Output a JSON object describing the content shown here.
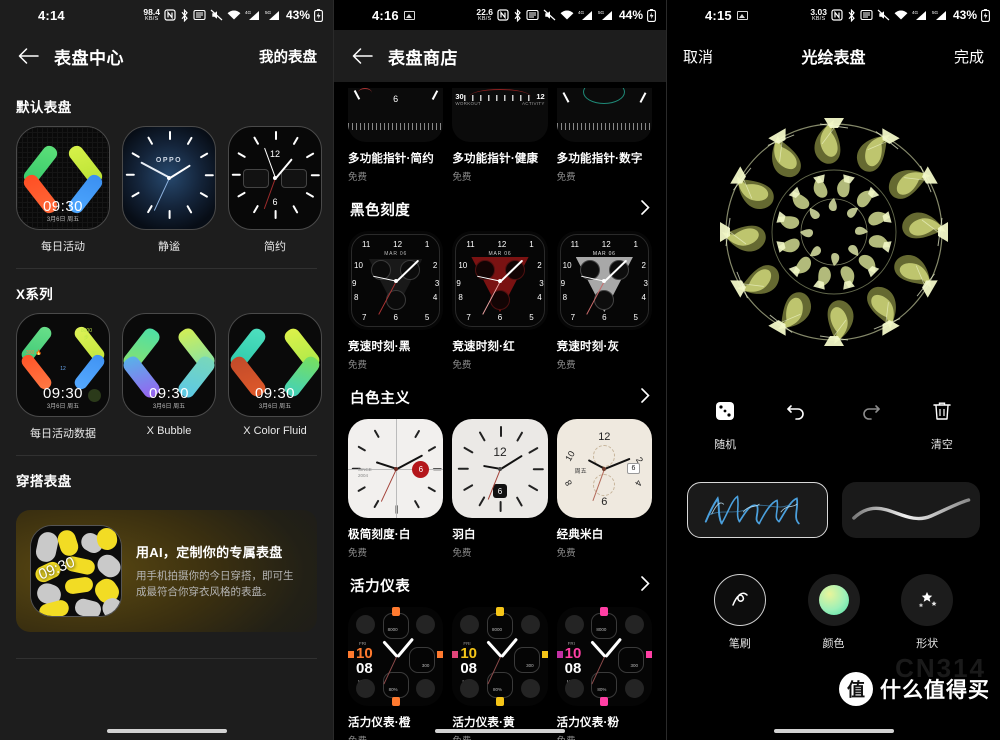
{
  "panel1": {
    "statusbar": {
      "time": "4:14",
      "net_speed": "98.4",
      "net_unit": "KB/S",
      "battery": "43%",
      "icons": [
        "nfc-icon",
        "bluetooth-icon",
        "screenshot-icon",
        "mute-icon",
        "wifi-icon",
        "signal-4g-icon",
        "signal-5g-icon",
        "battery-icon"
      ]
    },
    "header": {
      "back": "back-arrow-icon",
      "title": "表盘中心",
      "action": "我的表盘"
    },
    "sections": [
      {
        "title": "默认表盘",
        "faces": [
          {
            "label": "每日活动",
            "time": "09:30",
            "date": "3月6日 周五"
          },
          {
            "label": "静谧",
            "time": "",
            "date": ""
          },
          {
            "label": "简约",
            "time": "",
            "date": ""
          },
          {
            "label": "",
            "time": "",
            "date": ""
          }
        ]
      },
      {
        "title": "X系列",
        "faces": [
          {
            "label": "每日活动数据",
            "time": "09:30",
            "date": "3月6日 周五"
          },
          {
            "label": "X Bubble",
            "time": "09:30",
            "date": "3月6日 周五"
          },
          {
            "label": "X Color Fluid",
            "time": "09:30",
            "date": "3月6日 周五"
          },
          {
            "label": "",
            "time": "",
            "date": ""
          }
        ]
      },
      {
        "title": "穿搭表盘",
        "faces": []
      }
    ],
    "banner": {
      "time": "09:30",
      "heading": "用AI，定制你的专属表盘",
      "body": "用手机拍摄你的今日穿搭，即可生成最符合你穿衣风格的表盘。"
    }
  },
  "panel2": {
    "statusbar": {
      "time": "4:16",
      "net_speed": "22.6",
      "net_unit": "KB/S",
      "battery": "44%"
    },
    "header": {
      "back": "back-arrow-icon",
      "title": "表盘商店"
    },
    "top_partial": [
      {
        "name": "多功能指针·简约",
        "price": "免费",
        "dial_label": "6"
      },
      {
        "name": "多功能指针·健康",
        "price": "免费",
        "dial_left": "30",
        "dial_left_sub": "WORKOUT",
        "dial_right": "12",
        "dial_right_sub": "ACTIVITY"
      },
      {
        "name": "多功能指针·数字",
        "price": "免费",
        "dial_label": ""
      }
    ],
    "sections": [
      {
        "title": "黑色刻度",
        "more": "chevron-right-icon",
        "cards": [
          {
            "name": "竞速时刻·黑",
            "price": "免费",
            "date": "MAR 06",
            "accent": "#2a2a2a"
          },
          {
            "name": "竞速时刻·红",
            "price": "免费",
            "date": "MAR 06",
            "accent": "#7a1212"
          },
          {
            "name": "竞速时刻·灰",
            "price": "免费",
            "date": "MAR 06",
            "accent": "#9a9a9a"
          }
        ]
      },
      {
        "title": "白色主义",
        "more": "chevron-right-icon",
        "cards": [
          {
            "name": "极简刻度·白",
            "price": "免费",
            "accent": "#f2f0ee"
          },
          {
            "name": "羽白",
            "price": "免费",
            "accent": "#ebe9e6"
          },
          {
            "name": "经典米白",
            "price": "免费",
            "accent": "#efe9df"
          }
        ]
      },
      {
        "title": "活力仪表",
        "more": "chevron-right-icon",
        "cards": [
          {
            "name": "活力仪表·橙",
            "price": "免费",
            "accent": "#ff7a2f",
            "day": "FRI",
            "hour": "10",
            "min": "08",
            "month": "MAR",
            "steps": "8000",
            "cal": "300",
            "batt": "80%"
          },
          {
            "name": "活力仪表·黄",
            "price": "免费",
            "accent": "#f5c518",
            "day": "FRI",
            "hour": "10",
            "min": "08",
            "month": "MAR",
            "steps": "8000",
            "cal": "300",
            "batt": "80%"
          },
          {
            "name": "活力仪表·粉",
            "price": "免费",
            "accent": "#ff3fa4",
            "day": "FRI",
            "hour": "10",
            "min": "08",
            "month": "MAR",
            "steps": "8000",
            "cal": "300",
            "batt": "80%"
          }
        ]
      }
    ]
  },
  "panel3": {
    "statusbar": {
      "time": "4:15",
      "net_speed": "3.03",
      "net_unit": "KB/S",
      "battery": "43%"
    },
    "header": {
      "cancel": "取消",
      "title": "光绘表盘",
      "done": "完成"
    },
    "artwork": {
      "name": "light-painting-mandala",
      "color": "#e8f0a0"
    },
    "tools": [
      {
        "icon": "dice-icon",
        "label": "随机"
      },
      {
        "icon": "undo-icon",
        "label": ""
      },
      {
        "icon": "redo-icon",
        "label": ""
      },
      {
        "icon": "trash-icon",
        "label": "清空"
      }
    ],
    "previews": [
      {
        "name": "preview-light-strokes",
        "selected": true
      },
      {
        "name": "preview-smooth-curve",
        "selected": false
      }
    ],
    "bottom_tools": [
      {
        "icon": "brush-icon",
        "label": "笔刷",
        "selected": true
      },
      {
        "icon": "color-swatch",
        "label": "颜色",
        "color": "#7ef0b0"
      },
      {
        "icon": "shape-sparkle-icon",
        "label": "形状"
      }
    ],
    "watermark": {
      "badge": "值",
      "text": "什么值得买",
      "ghost": "CN314"
    }
  }
}
